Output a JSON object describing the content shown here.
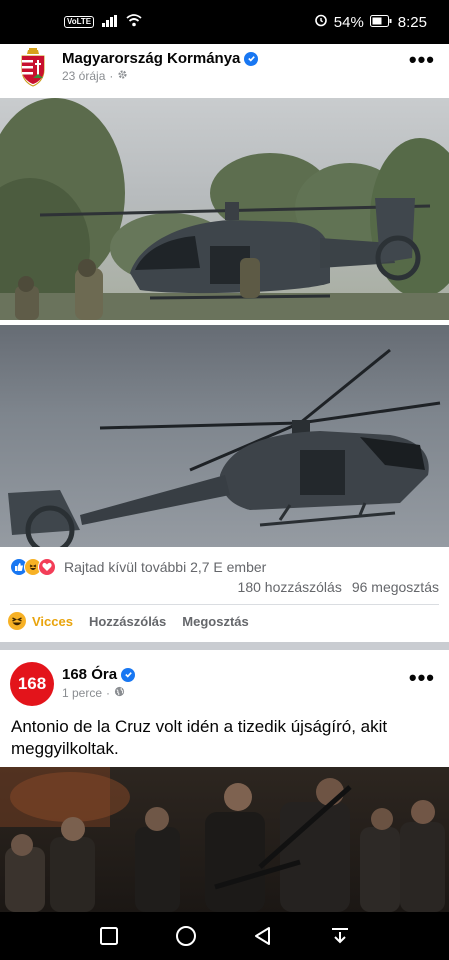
{
  "status_bar": {
    "network_badge": "VoLTE",
    "battery_percent": "54%",
    "time": "8:25"
  },
  "post1": {
    "page_name": "Magyarország Kormánya",
    "time_ago": "23 órája",
    "time_separator": "·",
    "reactions_text": "Rajtad kívül további 2,7 E ember",
    "comments_count": "180 hozzászólás",
    "shares_count": "96 megosztás",
    "actions": {
      "react_label": "Vicces",
      "comment_label": "Hozzászólás",
      "share_label": "Megosztás"
    }
  },
  "post2": {
    "avatar_text": "168",
    "page_name": "168 Óra",
    "time_ago": "1 perce",
    "time_separator": "·",
    "text": "Antonio de la Cruz volt idén a tizedik újságíró, akit meggyilkoltak."
  },
  "colors": {
    "brand_blue": "#1877f2",
    "haha_yellow": "#f7b125",
    "love_red": "#f33e58",
    "ora_red": "#e3141b"
  },
  "icons": {
    "verified": "verified-badge-icon",
    "more": "more-dots-icon",
    "nav_recent": "square-icon",
    "nav_home": "circle-icon",
    "nav_back": "triangle-back-icon",
    "nav_notif": "pull-down-icon"
  }
}
